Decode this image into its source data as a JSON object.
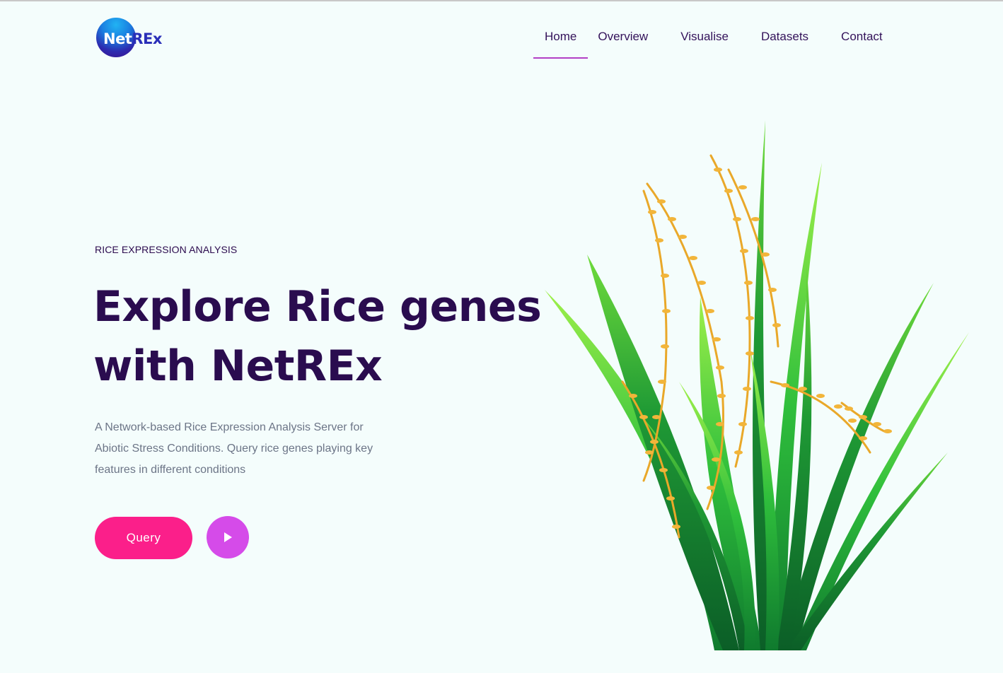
{
  "header": {
    "logo": {
      "part1": "Net",
      "part2": "REx"
    },
    "nav": [
      {
        "label": "Home",
        "active": true
      },
      {
        "label": "Overview",
        "active": false
      },
      {
        "label": "Visualise",
        "active": false
      },
      {
        "label": "Datasets",
        "active": false
      },
      {
        "label": "Contact",
        "active": false
      }
    ]
  },
  "hero": {
    "eyebrow": "RICE EXPRESSION ANALYSIS",
    "headline_line1": "Explore Rice genes",
    "headline_line2": "with NetREx",
    "description": "A Network-based Rice Expression Analysis Server for Abiotic Stress Conditions. Query rice genes playing key features in different conditions",
    "query_button": "Query",
    "play_icon": "play-icon",
    "image": "rice-plant-illustration"
  },
  "colors": {
    "background": "#f4fdfc",
    "heading": "#2a0c4f",
    "nav_text": "#33125a",
    "nav_active_underline": "#b23fc5",
    "query_button": "#fb1f8a",
    "play_button": "#d54be9",
    "body_text": "#6c7587"
  }
}
